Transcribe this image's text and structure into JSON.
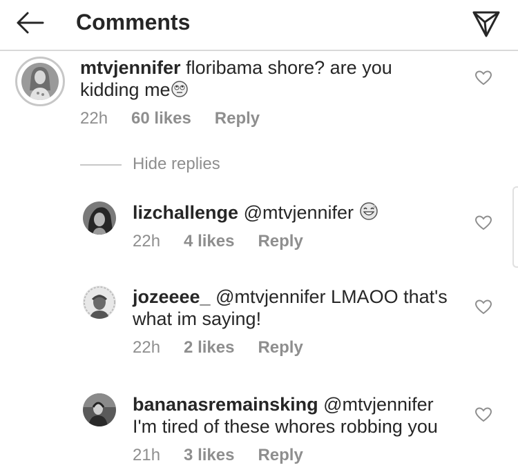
{
  "header": {
    "title": "Comments"
  },
  "main_comment": {
    "username": "mtvjennifer",
    "text": "floribama shore? are you kidding me",
    "time": "22h",
    "likes": "60 likes",
    "reply": "Reply"
  },
  "hide_replies": "Hide replies",
  "replies": [
    {
      "username": "lizchallenge",
      "text": "@mtvjennifer",
      "time": "22h",
      "likes": "4 likes",
      "reply": "Reply"
    },
    {
      "username": "jozeeee_",
      "text": "@mtvjennifer LMAOO that's",
      "text2": "what im saying!",
      "time": "22h",
      "likes": "2 likes",
      "reply": "Reply"
    },
    {
      "username": "bananasremainsking",
      "text": "@mtvjennifer",
      "text2": "I'm tired of these whores robbing you",
      "time": "21h",
      "likes": "3 likes",
      "reply": "Reply"
    }
  ],
  "icons": {
    "back": "arrow-left-icon",
    "direct": "paper-plane-icon",
    "heart": "heart-outline-icon"
  }
}
